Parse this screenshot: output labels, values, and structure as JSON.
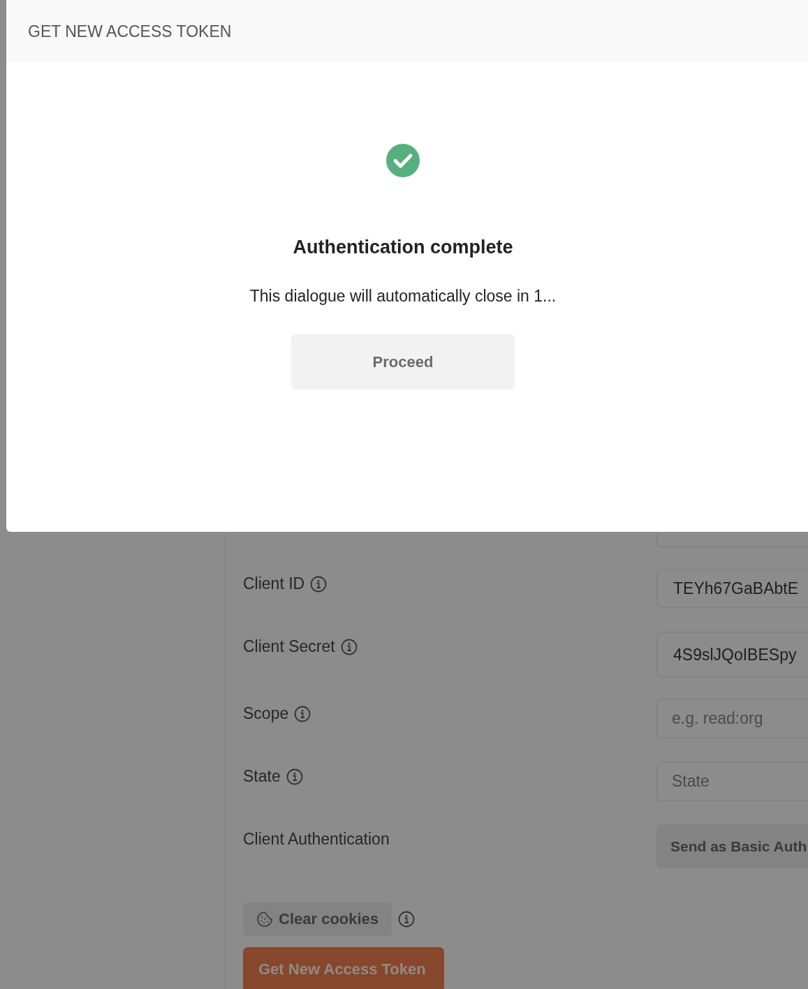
{
  "dialog": {
    "title": "GET NEW ACCESS TOKEN",
    "heading": "Authentication complete",
    "message": "This dialogue will automatically close in 1...",
    "button": "Proceed"
  },
  "form": {
    "rows": [
      {
        "label": "Client ID",
        "info": true,
        "kind": "input",
        "value": "TEYh67GaBAbtE"
      },
      {
        "label": "Client Secret",
        "info": true,
        "kind": "input",
        "value": "4S9slJQoIBESpy"
      },
      {
        "label": "Scope",
        "info": true,
        "kind": "input",
        "placeholder": "e.g. read:org"
      },
      {
        "label": "State",
        "info": true,
        "kind": "input",
        "placeholder": "State"
      },
      {
        "label": "Client Authentication",
        "info": false,
        "kind": "select",
        "value": "Send as Basic Auth"
      }
    ],
    "clear_cookies": "Clear cookies",
    "submit": "Get New Access Token"
  }
}
